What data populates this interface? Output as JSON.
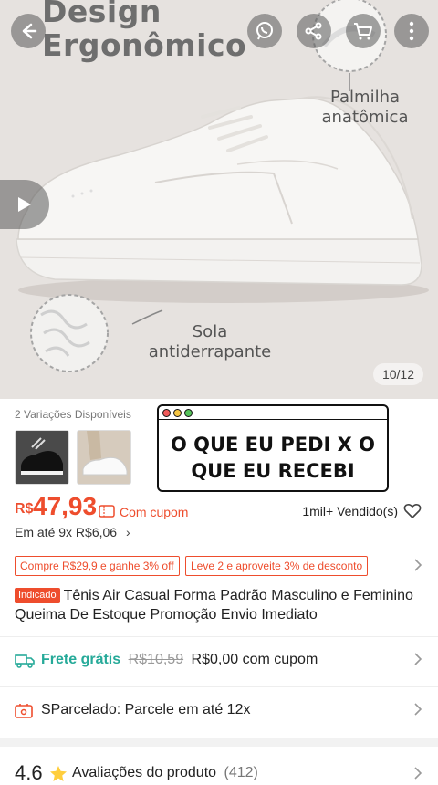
{
  "hero": {
    "title_line1": "Design",
    "title_line2": "Ergonômico",
    "note_insole_line1": "Palmilha",
    "note_insole_line2": "anatômica",
    "note_sole_line1": "Sola",
    "note_sole_line2": "antiderrapante",
    "image_counter": "10/12",
    "icons": [
      "back-arrow-icon",
      "whatsapp-icon",
      "share-icon",
      "cart-icon",
      "more-icon",
      "play-icon"
    ]
  },
  "variants": {
    "label": "2 Variações Disponíveis"
  },
  "popup": {
    "text_line1": "O QUE EU PEDI X O",
    "text_line2": "QUE EU RECEBI"
  },
  "price": {
    "currency": "R$",
    "value": "47,93",
    "coupon_label": "Com cupom",
    "sold": "1mil+ Vendido(s)",
    "installments": "Em até 9x R$6,06"
  },
  "promos": [
    "Compre R$29,9 e ganhe 3% off",
    "Leve 2 e aproveite 3% de desconto"
  ],
  "product": {
    "badge": "Indicado",
    "title": "Tênis Air Casual Forma Padrão Masculino e Feminino Queima De Estoque Promoção Envio Imediato"
  },
  "shipping": {
    "label": "Frete grátis",
    "old_price": "R$10,59",
    "new_price": "R$0,00 com cupom"
  },
  "parcelado": {
    "label": "SParcelado: Parcele em até 12x"
  },
  "reviews": {
    "rating": "4.6",
    "label": "Avaliações do produto",
    "count": "(412)"
  },
  "colors": {
    "accent": "#ee4d2d",
    "shipping_green": "#26aa99",
    "star": "#ffce3d"
  }
}
